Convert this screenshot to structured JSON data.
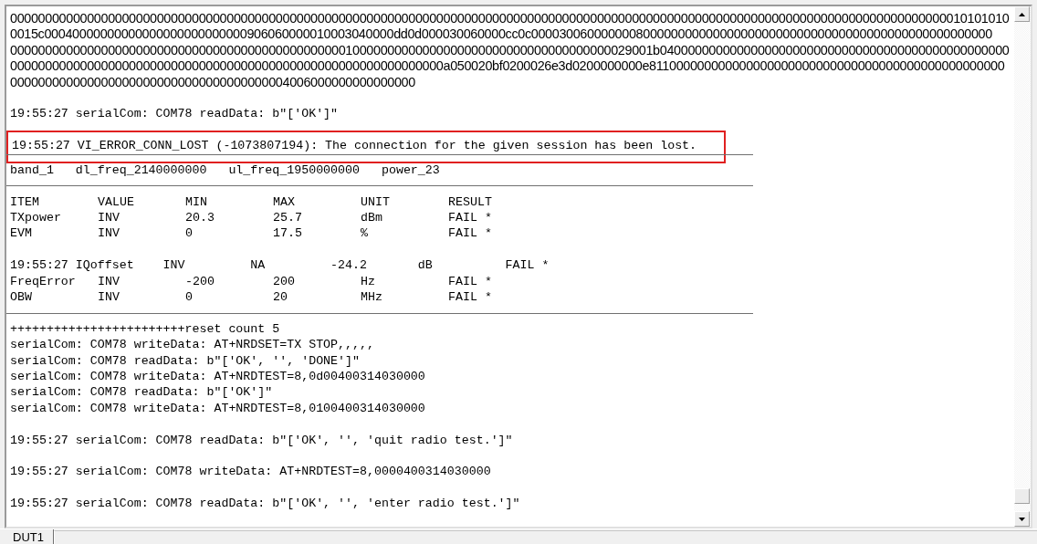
{
  "log": {
    "entries": [
      {
        "kind": "hex",
        "text": "00000000000000000000000000000000000000000000000000000000000000000000000000000000000000000000000000000000000000000000000000000000000000010101010"
      },
      {
        "kind": "hex",
        "text": "0015c00040000000000000000000000000906060000010003040000dd0d000030060000cc0c000030060000000800000000000000000000000000000000000000000000000000"
      },
      {
        "kind": "hex",
        "text": "00000000000000000000000000000000000000000000000010000000000000000000000000000000000000029001b04000000000000000000000000000000000000000000000000"
      },
      {
        "kind": "hex",
        "text": "00000000000000000000000000000000000000000000000000000000000000a050020bf0200026e3d0200000000e811000000000000000000000000000000000000000000000000"
      },
      {
        "kind": "hex",
        "text": "0000000000000000000000000000000000000004006000000000000000"
      },
      {
        "kind": "blank"
      },
      {
        "kind": "text",
        "text": "19:55:27 serialCom: COM78 readData: b\"['OK']\"",
        "highlighted": false
      },
      {
        "kind": "blank"
      },
      {
        "kind": "text",
        "text": "19:55:27 VI_ERROR_CONN_LOST (-1073807194): The connection for the given session has been lost.",
        "highlighted": true
      },
      {
        "kind": "rule"
      },
      {
        "kind": "text",
        "text": "band_1   dl_freq_2140000000   ul_freq_1950000000   power_23",
        "highlighted": false
      },
      {
        "kind": "rule"
      },
      {
        "kind": "table_row",
        "cells": [
          "ITEM",
          "VALUE",
          "MIN",
          "MAX",
          "UNIT",
          "RESULT"
        ]
      },
      {
        "kind": "table_row",
        "cells": [
          "TXpower",
          "INV",
          "20.3",
          "25.7",
          "dBm",
          "FAIL *"
        ]
      },
      {
        "kind": "table_row",
        "cells": [
          "EVM",
          "INV",
          "0",
          "17.5",
          "%",
          "FAIL *"
        ]
      },
      {
        "kind": "blank"
      },
      {
        "kind": "text",
        "text": "19:55:27 IQoffset    INV         NA         -24.2       dB          FAIL *",
        "highlighted": false
      },
      {
        "kind": "table_row",
        "cells": [
          "FreqError",
          "INV",
          "-200",
          "200",
          "Hz",
          "FAIL *"
        ]
      },
      {
        "kind": "table_row",
        "cells": [
          "OBW",
          "INV",
          "0",
          "20",
          "MHz",
          "FAIL *"
        ]
      },
      {
        "kind": "rule"
      },
      {
        "kind": "text",
        "text": "++++++++++++++++++++++++reset count 5",
        "highlighted": false
      },
      {
        "kind": "text",
        "text": "serialCom: COM78 writeData: AT+NRDSET=TX STOP,,,,,",
        "highlighted": false
      },
      {
        "kind": "text",
        "text": "serialCom: COM78 readData: b\"['OK', '', 'DONE']\"",
        "highlighted": false
      },
      {
        "kind": "text",
        "text": "serialCom: COM78 writeData: AT+NRDTEST=8,0d00400314030000",
        "highlighted": false
      },
      {
        "kind": "text",
        "text": "serialCom: COM78 readData: b\"['OK']\"",
        "highlighted": false
      },
      {
        "kind": "text",
        "text": "serialCom: COM78 writeData: AT+NRDTEST=8,0100400314030000",
        "highlighted": false
      },
      {
        "kind": "blank"
      },
      {
        "kind": "text",
        "text": "19:55:27 serialCom: COM78 readData: b\"['OK', '', 'quit radio test.']\"",
        "highlighted": false
      },
      {
        "kind": "blank"
      },
      {
        "kind": "text",
        "text": "19:55:27 serialCom: COM78 writeData: AT+NRDTEST=8,0000400314030000",
        "highlighted": false
      },
      {
        "kind": "blank"
      },
      {
        "kind": "text",
        "text": "19:55:27 serialCom: COM78 readData: b\"['OK', '', 'enter radio test.']\"",
        "highlighted": false
      }
    ]
  },
  "tabs": [
    {
      "label": "DUT1",
      "selected": true
    }
  ]
}
